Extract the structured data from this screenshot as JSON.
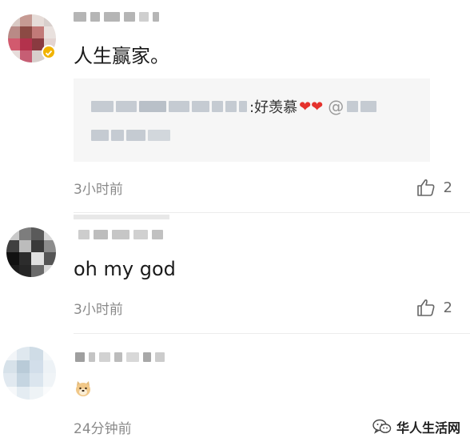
{
  "comments": [
    {
      "text": "人生赢家。",
      "quote": {
        "text": ":好羡慕"
      },
      "time": "3小时前",
      "likes": "2"
    },
    {
      "text": "oh my god",
      "time": "3小时前",
      "likes": "2"
    },
    {
      "text": "",
      "emoji": "doge-emoji",
      "time": "24分钟前"
    }
  ],
  "watermark": {
    "text": "华人生活网"
  },
  "icons": [
    "thumbs-up-icon",
    "verified-badge-icon",
    "heart-icon",
    "wechat-icon",
    "doge-emoji"
  ]
}
